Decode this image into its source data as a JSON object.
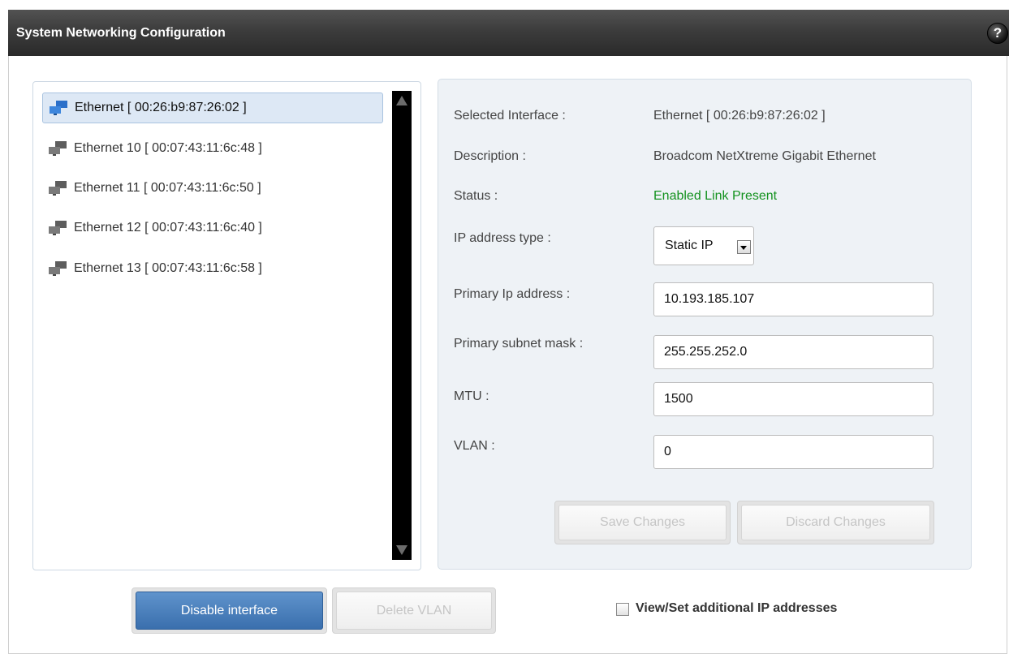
{
  "title": "System Networking Configuration",
  "help_label": "?",
  "interfaces": [
    {
      "label": "Ethernet [ 00:26:b9:87:26:02 ]",
      "selected": true,
      "icon": "network-blue-icon"
    },
    {
      "label": "Ethernet 10 [ 00:07:43:11:6c:48 ]",
      "selected": false,
      "icon": "network-gray-icon"
    },
    {
      "label": "Ethernet 11 [ 00:07:43:11:6c:50 ]",
      "selected": false,
      "icon": "network-gray-icon"
    },
    {
      "label": "Ethernet 12 [ 00:07:43:11:6c:40 ]",
      "selected": false,
      "icon": "network-gray-icon"
    },
    {
      "label": "Ethernet 13 [ 00:07:43:11:6c:58 ]",
      "selected": false,
      "icon": "network-gray-icon"
    }
  ],
  "details": {
    "selected_interface_label": "Selected Interface :",
    "selected_interface_value": "Ethernet [ 00:26:b9:87:26:02 ]",
    "description_label": "Description :",
    "description_value": "Broadcom NetXtreme Gigabit Ethernet",
    "status_label": "Status :",
    "status_value": "Enabled Link Present",
    "ip_type_label": "IP address type :",
    "ip_type_value": "Static IP",
    "primary_ip_label": "Primary Ip address :",
    "primary_ip_value": "10.193.185.107",
    "subnet_label": "Primary subnet mask :",
    "subnet_value": "255.255.252.0",
    "mtu_label": "MTU :",
    "mtu_value": "1500",
    "vlan_label": "VLAN :",
    "vlan_value": "0"
  },
  "buttons": {
    "save": "Save Changes",
    "discard": "Discard Changes",
    "disable": "Disable interface",
    "delete_vlan": "Delete VLAN"
  },
  "additional_ip_label": "View/Set additional IP addresses",
  "colors": {
    "status_ok": "#14921f",
    "primary_button": "#3a6fad",
    "title_bar": "#3c3c3c",
    "selection": "#dde8f5"
  }
}
